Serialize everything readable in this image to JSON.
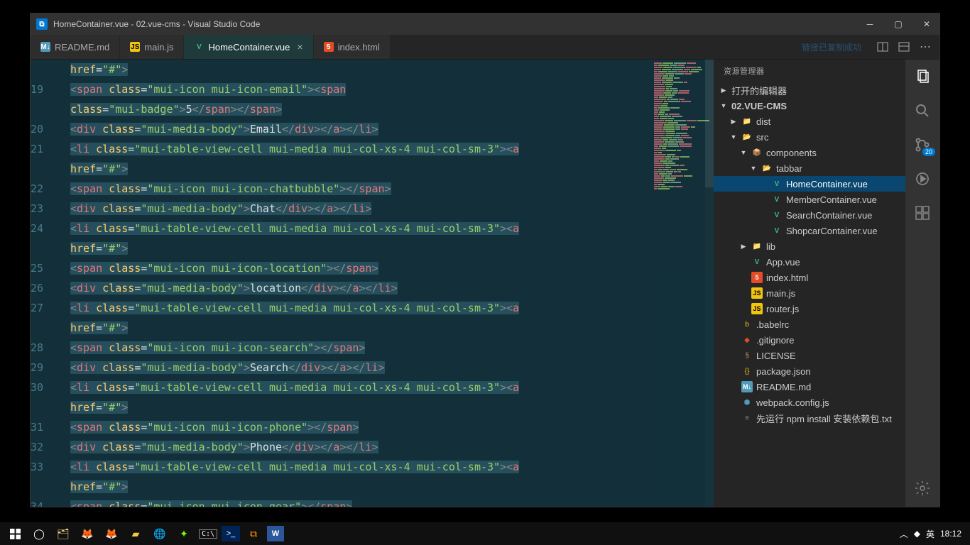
{
  "window": {
    "title": "HomeContainer.vue - 02.vue-cms - Visual Studio Code"
  },
  "tabs": [
    {
      "label": "README.md",
      "icon": "md",
      "active": false,
      "closeable": false
    },
    {
      "label": "main.js",
      "icon": "js",
      "active": false,
      "closeable": false
    },
    {
      "label": "HomeContainer.vue",
      "icon": "vue",
      "active": true,
      "closeable": true
    },
    {
      "label": "index.html",
      "icon": "html",
      "active": false,
      "closeable": false
    }
  ],
  "link_indicator": "链接已复制成功",
  "sidebar": {
    "title": "资源管理器",
    "section_open": "打开的编辑器",
    "badge_count": "20"
  },
  "tree": [
    {
      "depth": 0,
      "chev": "▶",
      "icon": "",
      "label": "打开的编辑器"
    },
    {
      "depth": 0,
      "chev": "▼",
      "icon": "",
      "label": "02.VUE-CMS",
      "bold": true
    },
    {
      "depth": 1,
      "chev": "▶",
      "icon": "folder",
      "label": "dist"
    },
    {
      "depth": 1,
      "chev": "▼",
      "icon": "folder-open",
      "label": "src"
    },
    {
      "depth": 2,
      "chev": "▼",
      "icon": "comp",
      "label": "components"
    },
    {
      "depth": 3,
      "chev": "▼",
      "icon": "folder-open",
      "label": "tabbar"
    },
    {
      "depth": 4,
      "chev": "",
      "icon": "vue",
      "label": "HomeContainer.vue",
      "selected": true
    },
    {
      "depth": 4,
      "chev": "",
      "icon": "vue",
      "label": "MemberContainer.vue"
    },
    {
      "depth": 4,
      "chev": "",
      "icon": "vue",
      "label": "SearchContainer.vue"
    },
    {
      "depth": 4,
      "chev": "",
      "icon": "vue",
      "label": "ShopcarContainer.vue"
    },
    {
      "depth": 2,
      "chev": "▶",
      "icon": "folder",
      "label": "lib"
    },
    {
      "depth": 2,
      "chev": "",
      "icon": "vue",
      "label": "App.vue"
    },
    {
      "depth": 2,
      "chev": "",
      "icon": "html",
      "label": "index.html"
    },
    {
      "depth": 2,
      "chev": "",
      "icon": "js",
      "label": "main.js"
    },
    {
      "depth": 2,
      "chev": "",
      "icon": "js",
      "label": "router.js"
    },
    {
      "depth": 1,
      "chev": "",
      "icon": "babel",
      "label": ".babelrc"
    },
    {
      "depth": 1,
      "chev": "",
      "icon": "git",
      "label": ".gitignore"
    },
    {
      "depth": 1,
      "chev": "",
      "icon": "lic",
      "label": "LICENSE"
    },
    {
      "depth": 1,
      "chev": "",
      "icon": "json",
      "label": "package.json"
    },
    {
      "depth": 1,
      "chev": "",
      "icon": "md",
      "label": "README.md"
    },
    {
      "depth": 1,
      "chev": "",
      "icon": "wp",
      "label": "webpack.config.js"
    },
    {
      "depth": 1,
      "chev": "",
      "icon": "txt",
      "label": "先运行 npm install 安装依赖包.txt"
    }
  ],
  "editor": {
    "line_numbers": [
      "",
      "19",
      "",
      "20",
      "21",
      "",
      "22",
      "23",
      "24",
      "",
      "25",
      "26",
      "27",
      "",
      "28",
      "29",
      "30",
      "",
      "31",
      "32",
      "33",
      "",
      "34"
    ],
    "lines": [
      {
        "indent": "      ",
        "raw": [
          {
            "t": "at",
            "v": "href"
          },
          {
            "t": "eq",
            "v": "="
          },
          {
            "t": "st",
            "v": "\"#\""
          },
          {
            "t": "br",
            "v": ">"
          }
        ]
      },
      {
        "indent": "            ",
        "raw": [
          {
            "t": "br",
            "v": "<"
          },
          {
            "t": "tg",
            "v": "span"
          },
          {
            "t": "tx",
            "v": " "
          },
          {
            "t": "at",
            "v": "class"
          },
          {
            "t": "eq",
            "v": "="
          },
          {
            "t": "st",
            "v": "\"mui-icon mui-icon-email\""
          },
          {
            "t": "br",
            "v": "><"
          },
          {
            "t": "tg",
            "v": "span"
          }
        ]
      },
      {
        "indent": "            ",
        "raw": [
          {
            "t": "at",
            "v": "class"
          },
          {
            "t": "eq",
            "v": "="
          },
          {
            "t": "st",
            "v": "\"mui-badge\""
          },
          {
            "t": "br",
            "v": ">"
          },
          {
            "t": "tx",
            "v": "5"
          },
          {
            "t": "br",
            "v": "</"
          },
          {
            "t": "tg",
            "v": "span"
          },
          {
            "t": "br",
            "v": "></"
          },
          {
            "t": "tg",
            "v": "span"
          },
          {
            "t": "br",
            "v": ">"
          }
        ]
      },
      {
        "indent": "            ",
        "raw": [
          {
            "t": "br",
            "v": "<"
          },
          {
            "t": "tg",
            "v": "div"
          },
          {
            "t": "tx",
            "v": " "
          },
          {
            "t": "at",
            "v": "class"
          },
          {
            "t": "eq",
            "v": "="
          },
          {
            "t": "st",
            "v": "\"mui-media-body\""
          },
          {
            "t": "br",
            "v": ">"
          },
          {
            "t": "tx",
            "v": "Email"
          },
          {
            "t": "br",
            "v": "</"
          },
          {
            "t": "tg",
            "v": "div"
          },
          {
            "t": "br",
            "v": "></"
          },
          {
            "t": "tg",
            "v": "a"
          },
          {
            "t": "br",
            "v": "></"
          },
          {
            "t": "tg",
            "v": "li"
          },
          {
            "t": "br",
            "v": ">"
          }
        ]
      },
      {
        "indent": "      ",
        "raw": [
          {
            "t": "br",
            "v": "<"
          },
          {
            "t": "tg",
            "v": "li"
          },
          {
            "t": "tx",
            "v": " "
          },
          {
            "t": "at",
            "v": "class"
          },
          {
            "t": "eq",
            "v": "="
          },
          {
            "t": "st",
            "v": "\"mui-table-view-cell mui-media mui-col-xs-4 mui-col-sm-3\""
          },
          {
            "t": "br",
            "v": "><"
          },
          {
            "t": "tg",
            "v": "a"
          }
        ]
      },
      {
        "indent": "      ",
        "raw": [
          {
            "t": "at",
            "v": "href"
          },
          {
            "t": "eq",
            "v": "="
          },
          {
            "t": "st",
            "v": "\"#\""
          },
          {
            "t": "br",
            "v": ">"
          }
        ]
      },
      {
        "indent": "            ",
        "raw": [
          {
            "t": "br",
            "v": "<"
          },
          {
            "t": "tg",
            "v": "span"
          },
          {
            "t": "tx",
            "v": " "
          },
          {
            "t": "at",
            "v": "class"
          },
          {
            "t": "eq",
            "v": "="
          },
          {
            "t": "st",
            "v": "\"mui-icon mui-icon-chatbubble\""
          },
          {
            "t": "br",
            "v": "></"
          },
          {
            "t": "tg",
            "v": "span"
          },
          {
            "t": "br",
            "v": ">"
          }
        ]
      },
      {
        "indent": "            ",
        "raw": [
          {
            "t": "br",
            "v": "<"
          },
          {
            "t": "tg",
            "v": "div"
          },
          {
            "t": "tx",
            "v": " "
          },
          {
            "t": "at",
            "v": "class"
          },
          {
            "t": "eq",
            "v": "="
          },
          {
            "t": "st",
            "v": "\"mui-media-body\""
          },
          {
            "t": "br",
            "v": ">"
          },
          {
            "t": "tx",
            "v": "Chat"
          },
          {
            "t": "br",
            "v": "</"
          },
          {
            "t": "tg",
            "v": "div"
          },
          {
            "t": "br",
            "v": "></"
          },
          {
            "t": "tg",
            "v": "a"
          },
          {
            "t": "br",
            "v": "></"
          },
          {
            "t": "tg",
            "v": "li"
          },
          {
            "t": "br",
            "v": ">"
          }
        ]
      },
      {
        "indent": "      ",
        "raw": [
          {
            "t": "br",
            "v": "<"
          },
          {
            "t": "tg",
            "v": "li"
          },
          {
            "t": "tx",
            "v": " "
          },
          {
            "t": "at",
            "v": "class"
          },
          {
            "t": "eq",
            "v": "="
          },
          {
            "t": "st",
            "v": "\"mui-table-view-cell mui-media mui-col-xs-4 mui-col-sm-3\""
          },
          {
            "t": "br",
            "v": "><"
          },
          {
            "t": "tg",
            "v": "a"
          }
        ]
      },
      {
        "indent": "      ",
        "raw": [
          {
            "t": "at",
            "v": "href"
          },
          {
            "t": "eq",
            "v": "="
          },
          {
            "t": "st",
            "v": "\"#\""
          },
          {
            "t": "br",
            "v": ">"
          }
        ]
      },
      {
        "indent": "            ",
        "raw": [
          {
            "t": "br",
            "v": "<"
          },
          {
            "t": "tg",
            "v": "span"
          },
          {
            "t": "tx",
            "v": " "
          },
          {
            "t": "at",
            "v": "class"
          },
          {
            "t": "eq",
            "v": "="
          },
          {
            "t": "st",
            "v": "\"mui-icon mui-icon-location\""
          },
          {
            "t": "br",
            "v": "></"
          },
          {
            "t": "tg",
            "v": "span"
          },
          {
            "t": "br",
            "v": ">"
          }
        ]
      },
      {
        "indent": "            ",
        "raw": [
          {
            "t": "br",
            "v": "<"
          },
          {
            "t": "tg",
            "v": "div"
          },
          {
            "t": "tx",
            "v": " "
          },
          {
            "t": "at",
            "v": "class"
          },
          {
            "t": "eq",
            "v": "="
          },
          {
            "t": "st",
            "v": "\"mui-media-body\""
          },
          {
            "t": "br",
            "v": ">"
          },
          {
            "t": "tx",
            "v": "location"
          },
          {
            "t": "br",
            "v": "</"
          },
          {
            "t": "tg",
            "v": "div"
          },
          {
            "t": "br",
            "v": "></"
          },
          {
            "t": "tg",
            "v": "a"
          },
          {
            "t": "br",
            "v": "></"
          },
          {
            "t": "tg",
            "v": "li"
          },
          {
            "t": "br",
            "v": ">"
          }
        ]
      },
      {
        "indent": "      ",
        "raw": [
          {
            "t": "br",
            "v": "<"
          },
          {
            "t": "tg",
            "v": "li"
          },
          {
            "t": "tx",
            "v": " "
          },
          {
            "t": "at",
            "v": "class"
          },
          {
            "t": "eq",
            "v": "="
          },
          {
            "t": "st",
            "v": "\"mui-table-view-cell mui-media mui-col-xs-4 mui-col-sm-3\""
          },
          {
            "t": "br",
            "v": "><"
          },
          {
            "t": "tg",
            "v": "a"
          }
        ]
      },
      {
        "indent": "      ",
        "raw": [
          {
            "t": "at",
            "v": "href"
          },
          {
            "t": "eq",
            "v": "="
          },
          {
            "t": "st",
            "v": "\"#\""
          },
          {
            "t": "br",
            "v": ">"
          }
        ]
      },
      {
        "indent": "            ",
        "raw": [
          {
            "t": "br",
            "v": "<"
          },
          {
            "t": "tg",
            "v": "span"
          },
          {
            "t": "tx",
            "v": " "
          },
          {
            "t": "at",
            "v": "class"
          },
          {
            "t": "eq",
            "v": "="
          },
          {
            "t": "st",
            "v": "\"mui-icon mui-icon-search\""
          },
          {
            "t": "br",
            "v": "></"
          },
          {
            "t": "tg",
            "v": "span"
          },
          {
            "t": "br",
            "v": ">"
          }
        ]
      },
      {
        "indent": "            ",
        "raw": [
          {
            "t": "br",
            "v": "<"
          },
          {
            "t": "tg",
            "v": "div"
          },
          {
            "t": "tx",
            "v": " "
          },
          {
            "t": "at",
            "v": "class"
          },
          {
            "t": "eq",
            "v": "="
          },
          {
            "t": "st",
            "v": "\"mui-media-body\""
          },
          {
            "t": "br",
            "v": ">"
          },
          {
            "t": "tx",
            "v": "Search"
          },
          {
            "t": "br",
            "v": "</"
          },
          {
            "t": "tg",
            "v": "div"
          },
          {
            "t": "br",
            "v": "></"
          },
          {
            "t": "tg",
            "v": "a"
          },
          {
            "t": "br",
            "v": "></"
          },
          {
            "t": "tg",
            "v": "li"
          },
          {
            "t": "br",
            "v": ">"
          }
        ]
      },
      {
        "indent": "      ",
        "raw": [
          {
            "t": "br",
            "v": "<"
          },
          {
            "t": "tg",
            "v": "li"
          },
          {
            "t": "tx",
            "v": " "
          },
          {
            "t": "at",
            "v": "class"
          },
          {
            "t": "eq",
            "v": "="
          },
          {
            "t": "st",
            "v": "\"mui-table-view-cell mui-media mui-col-xs-4 mui-col-sm-3\""
          },
          {
            "t": "br",
            "v": "><"
          },
          {
            "t": "tg",
            "v": "a"
          }
        ]
      },
      {
        "indent": "      ",
        "raw": [
          {
            "t": "at",
            "v": "href"
          },
          {
            "t": "eq",
            "v": "="
          },
          {
            "t": "st",
            "v": "\"#\""
          },
          {
            "t": "br",
            "v": ">"
          }
        ]
      },
      {
        "indent": "            ",
        "raw": [
          {
            "t": "br",
            "v": "<"
          },
          {
            "t": "tg",
            "v": "span"
          },
          {
            "t": "tx",
            "v": " "
          },
          {
            "t": "at",
            "v": "class"
          },
          {
            "t": "eq",
            "v": "="
          },
          {
            "t": "st",
            "v": "\"mui-icon mui-icon-phone\""
          },
          {
            "t": "br",
            "v": "></"
          },
          {
            "t": "tg",
            "v": "span"
          },
          {
            "t": "br",
            "v": ">"
          }
        ]
      },
      {
        "indent": "            ",
        "raw": [
          {
            "t": "br",
            "v": "<"
          },
          {
            "t": "tg",
            "v": "div"
          },
          {
            "t": "tx",
            "v": " "
          },
          {
            "t": "at",
            "v": "class"
          },
          {
            "t": "eq",
            "v": "="
          },
          {
            "t": "st",
            "v": "\"mui-media-body\""
          },
          {
            "t": "br",
            "v": ">"
          },
          {
            "t": "tx",
            "v": "Phone"
          },
          {
            "t": "br",
            "v": "</"
          },
          {
            "t": "tg",
            "v": "div"
          },
          {
            "t": "br",
            "v": "></"
          },
          {
            "t": "tg",
            "v": "a"
          },
          {
            "t": "br",
            "v": "></"
          },
          {
            "t": "tg",
            "v": "li"
          },
          {
            "t": "br",
            "v": ">"
          }
        ]
      },
      {
        "indent": "      ",
        "raw": [
          {
            "t": "br",
            "v": "<"
          },
          {
            "t": "tg",
            "v": "li"
          },
          {
            "t": "tx",
            "v": " "
          },
          {
            "t": "at",
            "v": "class"
          },
          {
            "t": "eq",
            "v": "="
          },
          {
            "t": "st",
            "v": "\"mui-table-view-cell mui-media mui-col-xs-4 mui-col-sm-3\""
          },
          {
            "t": "br",
            "v": "><"
          },
          {
            "t": "tg",
            "v": "a"
          }
        ]
      },
      {
        "indent": "      ",
        "raw": [
          {
            "t": "at",
            "v": "href"
          },
          {
            "t": "eq",
            "v": "="
          },
          {
            "t": "st",
            "v": "\"#\""
          },
          {
            "t": "br",
            "v": ">"
          }
        ]
      },
      {
        "indent": "            ",
        "raw": [
          {
            "t": "br",
            "v": "<"
          },
          {
            "t": "tg",
            "v": "span"
          },
          {
            "t": "tx",
            "v": " "
          },
          {
            "t": "at",
            "v": "class"
          },
          {
            "t": "eq",
            "v": "="
          },
          {
            "t": "st",
            "v": "\"mui-icon mui-icon-gear\""
          },
          {
            "t": "br",
            "v": "></"
          },
          {
            "t": "tg",
            "v": "span"
          },
          {
            "t": "br",
            "v": ">"
          }
        ]
      }
    ]
  },
  "taskbar": {
    "time": "18:12",
    "ime": "英"
  }
}
